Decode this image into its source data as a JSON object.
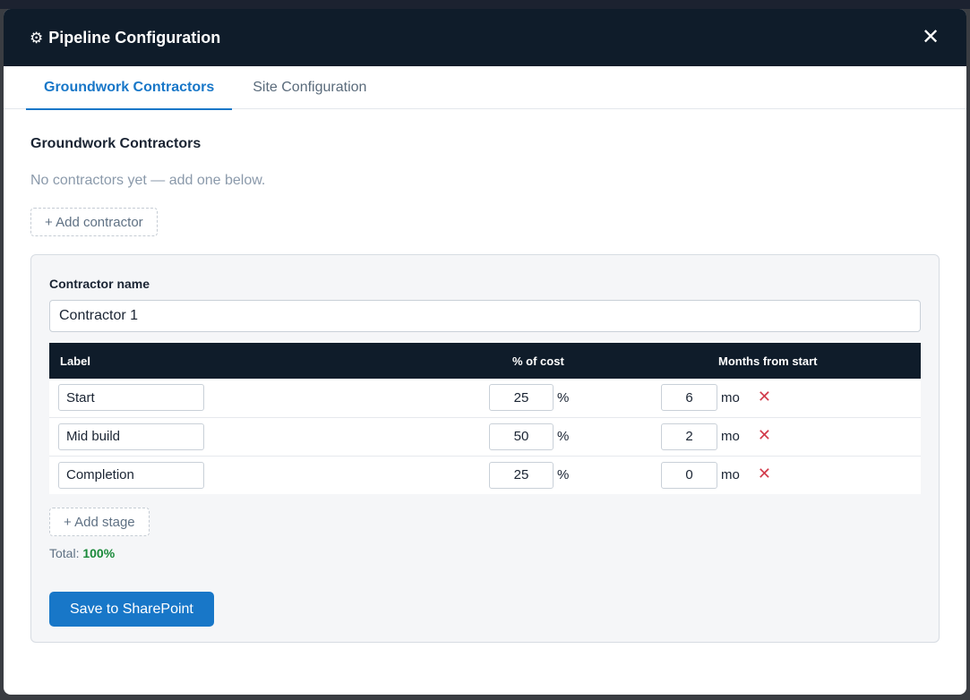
{
  "modal": {
    "title": "Pipeline Configuration",
    "gear_icon": "⚙",
    "close_icon": "✕"
  },
  "tabs": [
    {
      "label": "Groundwork Contractors",
      "active": true
    },
    {
      "label": "Site Configuration",
      "active": false
    }
  ],
  "section": {
    "title": "Groundwork Contractors",
    "empty_note": "No contractors yet — add one below.",
    "add_contractor_label": "+ Add contractor"
  },
  "contractor": {
    "name_label": "Contractor name",
    "name_value": "Contractor 1",
    "table_headers": {
      "label": "Label",
      "pct": "% of cost",
      "months": "Months from start"
    },
    "stages": [
      {
        "label": "Start",
        "pct": "25",
        "pct_unit": "%",
        "months": "6",
        "months_unit": "mo"
      },
      {
        "label": "Mid build",
        "pct": "50",
        "pct_unit": "%",
        "months": "2",
        "months_unit": "mo"
      },
      {
        "label": "Completion",
        "pct": "25",
        "pct_unit": "%",
        "months": "0",
        "months_unit": "mo"
      }
    ],
    "delete_icon": "✕",
    "add_stage_label": "+ Add stage",
    "total_label": "Total:",
    "total_value": "100%",
    "save_label": "Save to SharePoint"
  },
  "colors": {
    "header_bg": "#0f1c2a",
    "accent": "#1877c8",
    "success": "#1a8a3a",
    "danger": "#d23b4b"
  }
}
